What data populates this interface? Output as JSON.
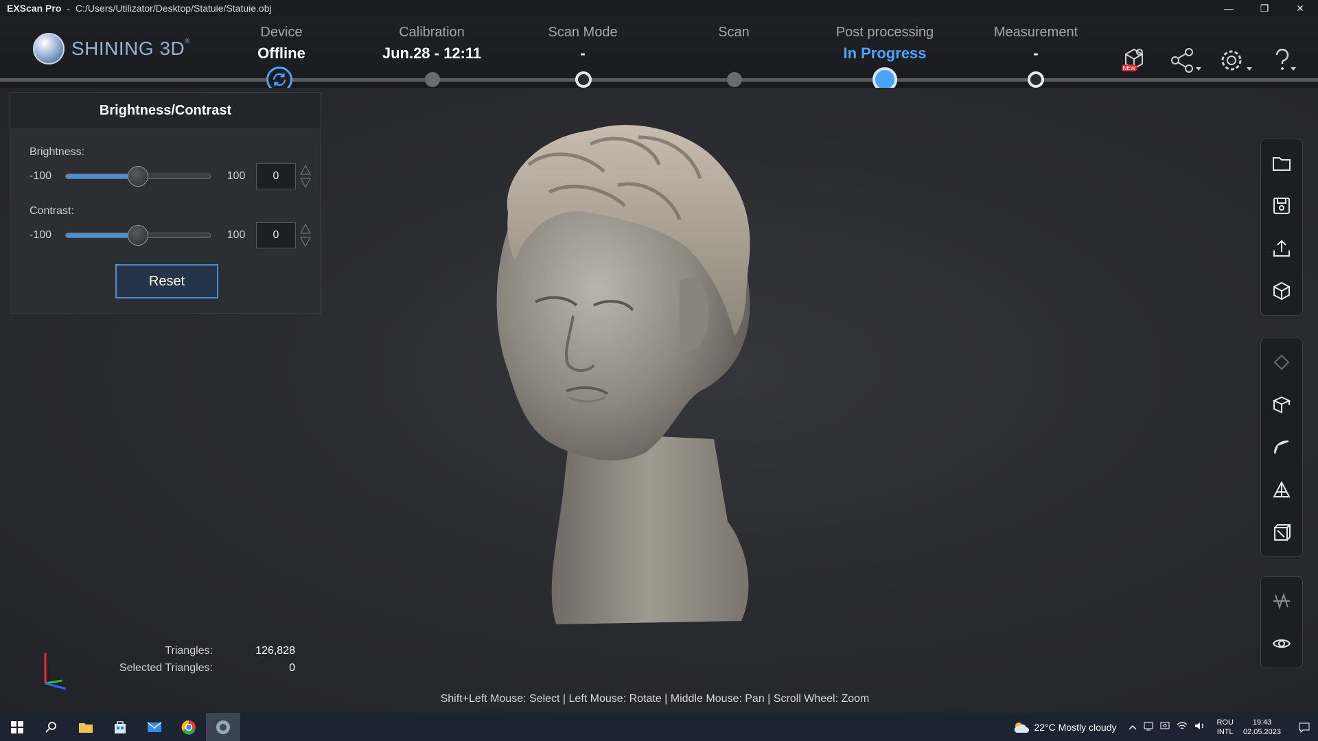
{
  "window": {
    "app_name": "EXScan Pro",
    "separator": "-",
    "file_path": "C:/Users/Utilizator/Desktop/Statuie/Statuie.obj",
    "minimize": "—",
    "restore": "❐",
    "close": "✕"
  },
  "logo": {
    "text": "SHINING 3D",
    "mark": "®"
  },
  "steps": [
    {
      "label": "Device",
      "status": "Offline"
    },
    {
      "label": "Calibration",
      "status": "Jun.28 - 12:11"
    },
    {
      "label": "Scan Mode",
      "status": "-"
    },
    {
      "label": "Scan",
      "status": ""
    },
    {
      "label": "Post processing",
      "status": "In Progress"
    },
    {
      "label": "Measurement",
      "status": "-"
    }
  ],
  "header_icons": [
    "new-feature-icon",
    "share-icon",
    "settings-icon",
    "help-icon"
  ],
  "panel": {
    "title": "Brightness/Contrast",
    "brightness": {
      "label": "Brightness:",
      "min": "-100",
      "max": "100",
      "value": "0",
      "level": 0.5
    },
    "contrast": {
      "label": "Contrast:",
      "min": "-100",
      "max": "100",
      "value": "0",
      "level": 0.5
    },
    "reset": "Reset"
  },
  "toolbar": {
    "file_group": [
      "folder-icon",
      "save-icon",
      "export-icon",
      "cube-icon"
    ],
    "edit_group": [
      "eraser-icon",
      "box-cut-icon",
      "curve-icon",
      "triangle-icon",
      "section-icon"
    ],
    "view_group": [
      "mesh-wave-icon",
      "eye-icon"
    ]
  },
  "stats": {
    "triangles_label": "Triangles:",
    "triangles_value": "126,828",
    "selected_label": "Selected Triangles:",
    "selected_value": "0"
  },
  "hint": "Shift+Left Mouse: Select | Left Mouse: Rotate | Middle Mouse: Pan | Scroll Wheel: Zoom",
  "taskbar": {
    "weather": "22°C  Mostly cloudy",
    "lang_top": "ROU",
    "lang_bottom": "INTL",
    "time": "19:43",
    "date": "02.05.2023"
  },
  "colors": {
    "accent": "#4aa3ff",
    "background": "#26272b"
  }
}
